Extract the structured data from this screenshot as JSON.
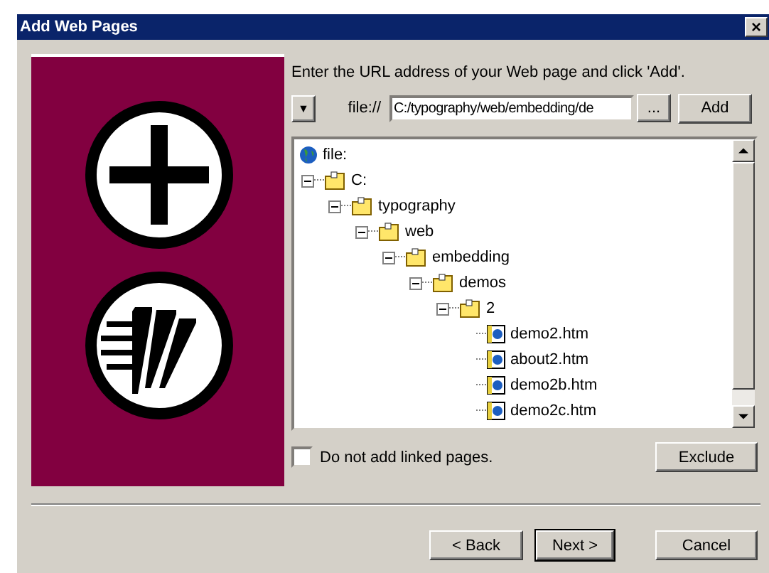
{
  "window": {
    "title": "Add Web Pages",
    "close_glyph": "×"
  },
  "instruction": "Enter the URL address of your Web page and click 'Add'.",
  "url_bar": {
    "dropdown_glyph": "▼",
    "scheme": "file://",
    "value": "C:/typography/web/embedding/de",
    "browse": "...",
    "add": "Add"
  },
  "tree": [
    {
      "kind": "globe",
      "label": "file:",
      "children": [
        {
          "kind": "folder",
          "label": "C:",
          "expanded": true,
          "children": [
            {
              "kind": "folder",
              "label": "typography",
              "expanded": true,
              "children": [
                {
                  "kind": "folder",
                  "label": "web",
                  "expanded": true,
                  "children": [
                    {
                      "kind": "folder",
                      "label": "embedding",
                      "expanded": true,
                      "children": [
                        {
                          "kind": "folder",
                          "label": "demos",
                          "expanded": true,
                          "children": [
                            {
                              "kind": "folder",
                              "label": "2",
                              "expanded": true,
                              "children": [
                                {
                                  "kind": "page",
                                  "label": "demo2.htm"
                                },
                                {
                                  "kind": "page",
                                  "label": "about2.htm"
                                },
                                {
                                  "kind": "page",
                                  "label": "demo2b.htm"
                                },
                                {
                                  "kind": "page",
                                  "label": "demo2c.htm"
                                }
                              ]
                            }
                          ]
                        }
                      ]
                    }
                  ]
                }
              ]
            }
          ]
        }
      ]
    }
  ],
  "linked_pages": {
    "label": "Do not add linked pages.",
    "checked": false
  },
  "exclude": "Exclude",
  "buttons": [
    {
      "label": "< Back",
      "default": false
    },
    {
      "label": "Next >",
      "default": true
    },
    {
      "label": "Cancel",
      "default": false
    }
  ]
}
